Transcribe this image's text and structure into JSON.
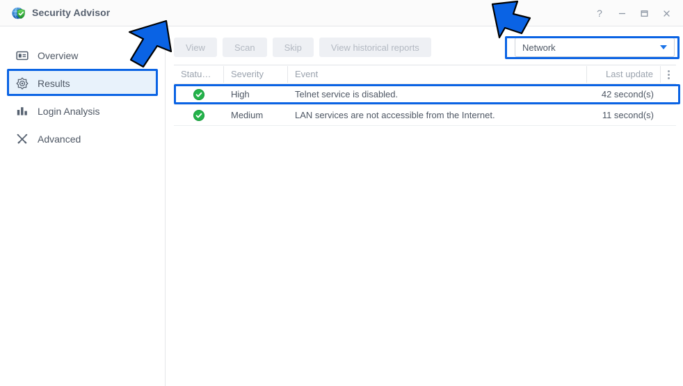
{
  "window": {
    "title": "Security Advisor",
    "app_icon": "shield-globe-icon",
    "controls": {
      "help": "?",
      "minimize": "–",
      "maximize": "❐",
      "close": "✕"
    }
  },
  "sidebar": {
    "items": [
      {
        "label": "Overview",
        "icon": "overview-card-icon",
        "selected": false
      },
      {
        "label": "Results",
        "icon": "target-icon",
        "selected": true
      },
      {
        "label": "Login Analysis",
        "icon": "bar-chart-icon",
        "selected": false
      },
      {
        "label": "Advanced",
        "icon": "tools-icon",
        "selected": false
      }
    ]
  },
  "toolbar": {
    "buttons": [
      {
        "label": "View",
        "enabled": false
      },
      {
        "label": "Scan",
        "enabled": false
      },
      {
        "label": "Skip",
        "enabled": false
      },
      {
        "label": "View historical reports",
        "enabled": false
      }
    ]
  },
  "filter": {
    "value": "Network",
    "icon": "chevron-down-icon"
  },
  "table": {
    "columns": [
      "Statu…",
      "Severity",
      "Event",
      "Last update"
    ],
    "overflow_icon": "more-vertical-icon",
    "rows": [
      {
        "status_icon": "check-circle-green-icon",
        "severity": "High",
        "event": "Telnet service is disabled.",
        "last_update": "42 second(s)",
        "highlighted": true
      },
      {
        "status_icon": "check-circle-green-icon",
        "severity": "Medium",
        "event": "LAN services are not accessible from the Internet.",
        "last_update": "11 second(s)",
        "highlighted": false
      }
    ]
  },
  "annotations": {
    "arrow_color": "#0a63e4",
    "highlight_color": "#0a63e4",
    "arrows": [
      {
        "name": "arrow-to-results-nav",
        "points_to": "Results"
      },
      {
        "name": "arrow-to-network-filter",
        "points_to": "Network"
      }
    ],
    "boxes": [
      {
        "name": "highlight-results-nav",
        "target": "Results"
      },
      {
        "name": "highlight-network-filter",
        "target": "Network"
      },
      {
        "name": "highlight-first-row",
        "target": "Telnet service is disabled."
      }
    ]
  },
  "colors": {
    "accent": "#0a63e4",
    "status_ok": "#23b34a",
    "selected_nav_bg": "#e8f2fb",
    "disabled_btn_bg": "#eef0f4",
    "text": "#4d5663",
    "muted_text": "#9aa2ad"
  }
}
